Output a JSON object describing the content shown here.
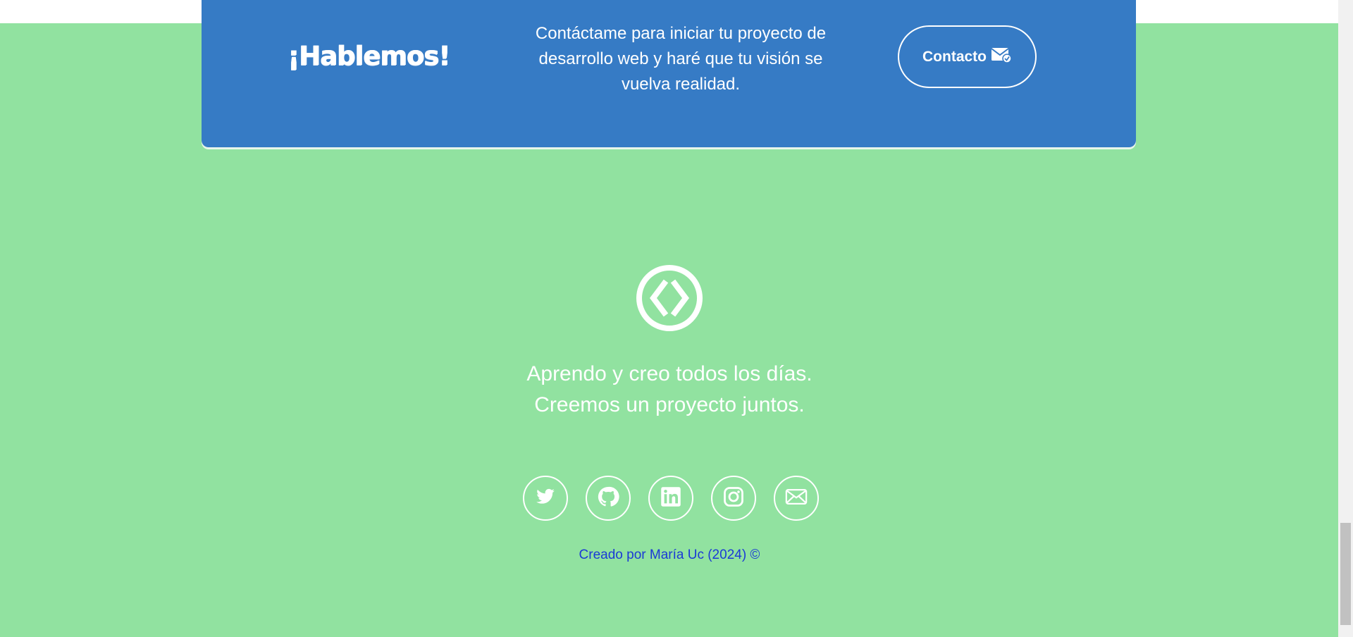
{
  "cta": {
    "title": "¡Hablemos!",
    "text": "Contáctame para iniciar tu proyecto de desarrollo web y haré que tu visión se vuelva realidad.",
    "button_label": "Contacto",
    "button_icon": "envelope-check-icon"
  },
  "footer": {
    "logo_icon": "code-brackets-icon",
    "tagline_line1": "Aprendo y creo todos los días.",
    "tagline_line2": "Creemos un proyecto juntos.",
    "socials": [
      {
        "icon": "twitter-icon"
      },
      {
        "icon": "github-icon"
      },
      {
        "icon": "linkedin-icon"
      },
      {
        "icon": "instagram-icon"
      },
      {
        "icon": "email-icon"
      }
    ],
    "credit": "Creado por María Uc (2024) ©"
  },
  "colors": {
    "background": "#91e2a0",
    "cta_background": "#367bc5",
    "credit_text": "#1a3ad6",
    "white": "#ffffff"
  }
}
